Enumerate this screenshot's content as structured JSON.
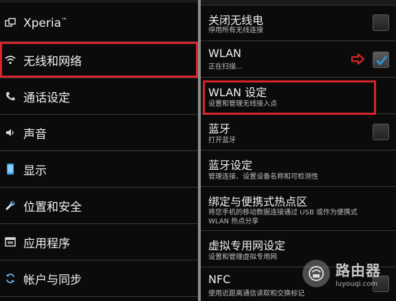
{
  "left_menu": {
    "items": [
      {
        "label": "Xperia",
        "tm": "™",
        "icon": "window-icon"
      },
      {
        "label": "无线和网络",
        "icon": "wifi-icon"
      },
      {
        "label": "通话设定",
        "icon": "phone-icon"
      },
      {
        "label": "声音",
        "icon": "speaker-icon"
      },
      {
        "label": "显示",
        "icon": "display-icon"
      },
      {
        "label": "位置和安全",
        "icon": "tools-icon"
      },
      {
        "label": "应用程序",
        "icon": "apps-icon"
      },
      {
        "label": "帐户与同步",
        "icon": "sync-icon"
      }
    ]
  },
  "right_settings": {
    "items": [
      {
        "title": "关闭无线电",
        "subtitle": "停用所有无线连接",
        "checkbox": false
      },
      {
        "title": "WLAN",
        "subtitle": "正在扫描...",
        "checkbox": true
      },
      {
        "title": "WLAN 设定",
        "subtitle": "设置和管理无线接入点"
      },
      {
        "title": "蓝牙",
        "subtitle": "打开蓝牙",
        "checkbox": false
      },
      {
        "title": "蓝牙设定",
        "subtitle": "管理连接、设置设备名称和可检测性"
      },
      {
        "title": "绑定与便携式热点区",
        "subtitle": "将您手机的移动数据连接通过 USB 或作为便携式",
        "subtitle2": "WLAN 热点分享"
      },
      {
        "title": "虚拟专用网设定",
        "subtitle": "设置和管理虚拟专用网"
      },
      {
        "title": "NFC",
        "subtitle": "使用近距离通信读取和交换标记"
      }
    ]
  },
  "watermark": {
    "name": "路由器",
    "domain": "luyouqi.com"
  },
  "colors": {
    "highlight": "#d8252b",
    "checkmark": "#2d8fd5",
    "arrow": "#d8252b"
  }
}
